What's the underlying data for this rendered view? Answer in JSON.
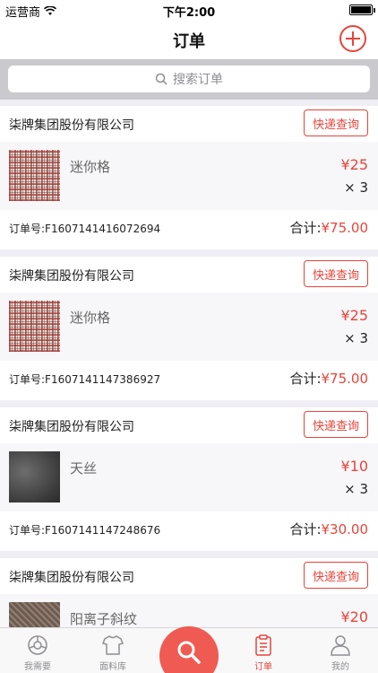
{
  "status": {
    "carrier": "运营商",
    "time": "下午2:00"
  },
  "nav": {
    "title": "订单"
  },
  "search": {
    "placeholder": "搜索订单"
  },
  "orders": [
    {
      "shop": "柒牌集团股份有限公司",
      "track_label": "快递查询",
      "product": "迷你格",
      "price": "¥25",
      "qty": "× 3",
      "order_no": "订单号:F1607141416072694",
      "total_label": "合计:",
      "total": "¥75.00"
    },
    {
      "shop": "柒牌集团股份有限公司",
      "track_label": "快递查询",
      "product": "迷你格",
      "price": "¥25",
      "qty": "× 3",
      "order_no": "订单号:F1607141147386927",
      "total_label": "合计:",
      "total": "¥75.00"
    },
    {
      "shop": "柒牌集团股份有限公司",
      "track_label": "快递查询",
      "product": "天丝",
      "price": "¥10",
      "qty": "× 3",
      "order_no": "订单号:F1607141147248676",
      "total_label": "合计:",
      "total": "¥30.00"
    },
    {
      "shop": "柒牌集团股份有限公司",
      "track_label": "快递查询",
      "product": "阳离子斜纹",
      "price": "¥20"
    }
  ],
  "tabs": [
    {
      "label": "我需要",
      "icon": "compass-icon"
    },
    {
      "label": "面料库",
      "icon": "shirt-icon"
    },
    {
      "label": "",
      "icon": "search-icon"
    },
    {
      "label": "订单",
      "icon": "clipboard-icon"
    },
    {
      "label": "我的",
      "icon": "person-icon"
    }
  ],
  "colors": {
    "accent": "#e8443a",
    "fab": "#ef5a52",
    "background": "#efeef4"
  }
}
